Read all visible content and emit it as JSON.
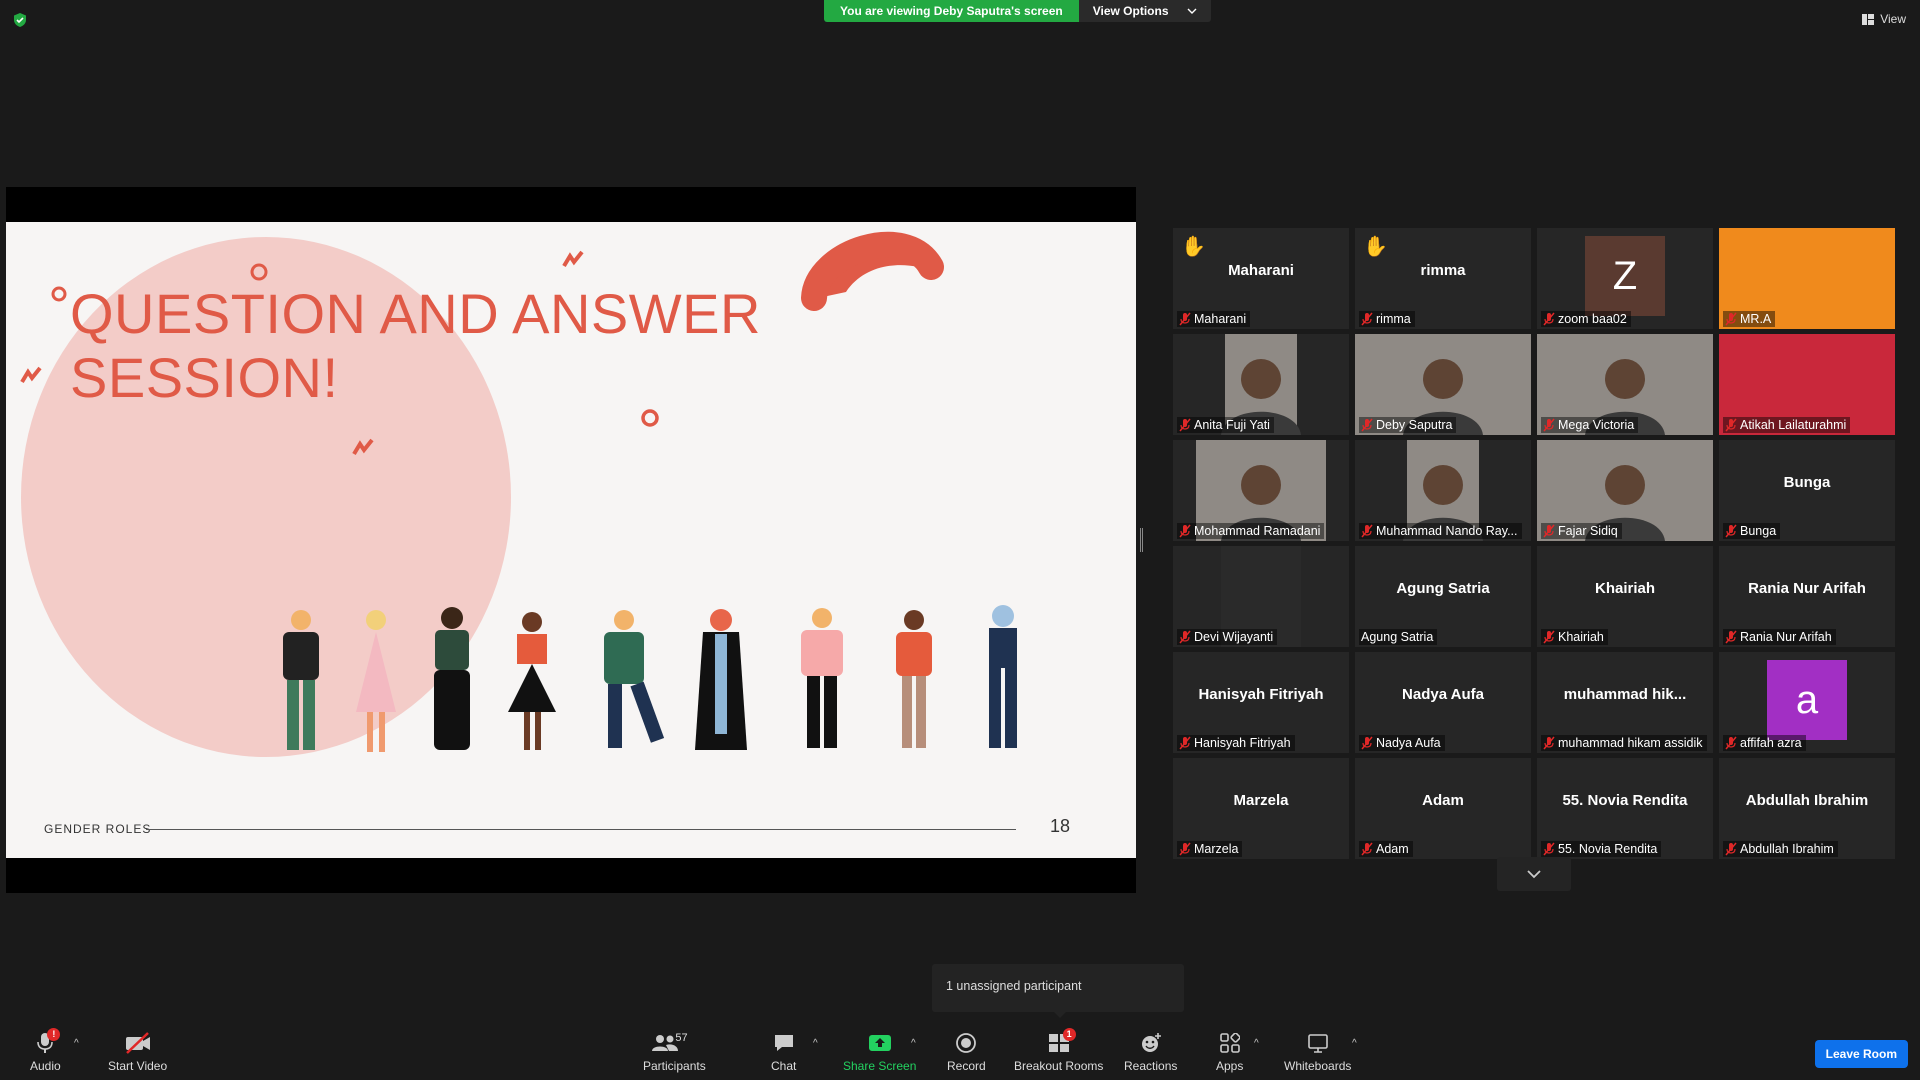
{
  "top_bar": {
    "viewing_text": "You are viewing Deby Saputra's screen",
    "view_options_label": "View Options",
    "view_label": "View"
  },
  "slide": {
    "title_line1": "QUESTION AND ANSWER",
    "title_line2": "SESSION!",
    "footer_label": "GENDER ROLES",
    "page_number": "18"
  },
  "gallery": {
    "tiles": [
      {
        "center": "Maharani",
        "label": "Maharani",
        "hand": true
      },
      {
        "center": "rimma",
        "label": "rimma",
        "hand": true
      },
      {
        "center": "",
        "label": "zoom baa02",
        "avatar_letter": "Z",
        "avatar_color": "#5a3a30"
      },
      {
        "center": "",
        "label": "MR.A",
        "video": "orange"
      },
      {
        "center": "",
        "label": "Anita Fuji Yati",
        "video": "person"
      },
      {
        "center": "",
        "label": "Deby Saputra",
        "video": "person",
        "active": true
      },
      {
        "center": "",
        "label": "Mega Victoria",
        "video": "person"
      },
      {
        "center": "",
        "label": "Atikah Lailaturahmi",
        "video": "red"
      },
      {
        "center": "",
        "label": "Mohammad Ramadani",
        "video": "person"
      },
      {
        "center": "",
        "label": "Muhammad Nando Ray...",
        "video": "person"
      },
      {
        "center": "",
        "label": "Fajar Sidiq",
        "video": "person"
      },
      {
        "center": "Bunga",
        "label": "Bunga"
      },
      {
        "center": "",
        "label": "Devi Wijayanti",
        "video": "logo"
      },
      {
        "center": "Agung Satria",
        "label": "Agung Satria",
        "no_mic": true
      },
      {
        "center": "Khairiah",
        "label": "Khairiah"
      },
      {
        "center": "Rania Nur Arifah",
        "label": "Rania Nur Arifah"
      },
      {
        "center": "Hanisyah Fitriyah",
        "label": "Hanisyah Fitriyah"
      },
      {
        "center": "Nadya Aufa",
        "label": "Nadya Aufa"
      },
      {
        "center": "muhammad  hik...",
        "label": "muhammad hikam assidik"
      },
      {
        "center": "",
        "label": "affifah azra",
        "avatar_letter": "a",
        "avatar_color": "#a22fc4"
      },
      {
        "center": "Marzela",
        "label": "Marzela"
      },
      {
        "center": "Adam",
        "label": "Adam"
      },
      {
        "center": "55. Novia Rendita",
        "label": "55. Novia Rendita"
      },
      {
        "center": "Abdullah Ibrahim",
        "label": "Abdullah Ibrahim"
      }
    ]
  },
  "tooltip": {
    "unassigned": "1 unassigned participant"
  },
  "toolbar": {
    "audio": "Audio",
    "audio_badge": "!",
    "start_video": "Start Video",
    "participants": "Participants",
    "participants_count": "57",
    "chat": "Chat",
    "share_screen": "Share Screen",
    "record": "Record",
    "breakout_rooms": "Breakout Rooms",
    "breakout_badge": "1",
    "reactions": "Reactions",
    "apps": "Apps",
    "whiteboards": "Whiteboards",
    "leave_room": "Leave Room"
  }
}
